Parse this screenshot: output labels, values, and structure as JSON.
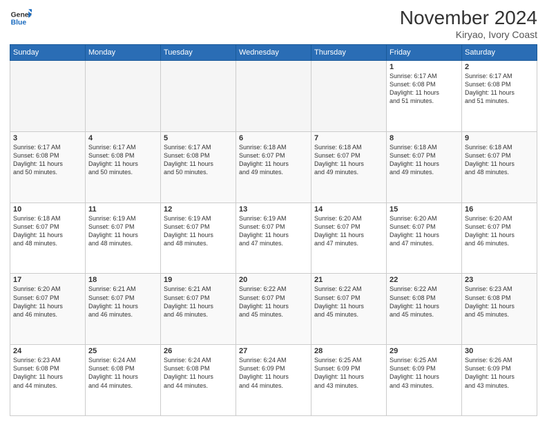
{
  "header": {
    "logo_line1": "General",
    "logo_line2": "Blue",
    "main_title": "November 2024",
    "subtitle": "Kiryao, Ivory Coast"
  },
  "weekdays": [
    "Sunday",
    "Monday",
    "Tuesday",
    "Wednesday",
    "Thursday",
    "Friday",
    "Saturday"
  ],
  "weeks": [
    [
      {
        "day": "",
        "info": ""
      },
      {
        "day": "",
        "info": ""
      },
      {
        "day": "",
        "info": ""
      },
      {
        "day": "",
        "info": ""
      },
      {
        "day": "",
        "info": ""
      },
      {
        "day": "1",
        "info": "Sunrise: 6:17 AM\nSunset: 6:08 PM\nDaylight: 11 hours\nand 51 minutes."
      },
      {
        "day": "2",
        "info": "Sunrise: 6:17 AM\nSunset: 6:08 PM\nDaylight: 11 hours\nand 51 minutes."
      }
    ],
    [
      {
        "day": "3",
        "info": "Sunrise: 6:17 AM\nSunset: 6:08 PM\nDaylight: 11 hours\nand 50 minutes."
      },
      {
        "day": "4",
        "info": "Sunrise: 6:17 AM\nSunset: 6:08 PM\nDaylight: 11 hours\nand 50 minutes."
      },
      {
        "day": "5",
        "info": "Sunrise: 6:17 AM\nSunset: 6:08 PM\nDaylight: 11 hours\nand 50 minutes."
      },
      {
        "day": "6",
        "info": "Sunrise: 6:18 AM\nSunset: 6:07 PM\nDaylight: 11 hours\nand 49 minutes."
      },
      {
        "day": "7",
        "info": "Sunrise: 6:18 AM\nSunset: 6:07 PM\nDaylight: 11 hours\nand 49 minutes."
      },
      {
        "day": "8",
        "info": "Sunrise: 6:18 AM\nSunset: 6:07 PM\nDaylight: 11 hours\nand 49 minutes."
      },
      {
        "day": "9",
        "info": "Sunrise: 6:18 AM\nSunset: 6:07 PM\nDaylight: 11 hours\nand 48 minutes."
      }
    ],
    [
      {
        "day": "10",
        "info": "Sunrise: 6:18 AM\nSunset: 6:07 PM\nDaylight: 11 hours\nand 48 minutes."
      },
      {
        "day": "11",
        "info": "Sunrise: 6:19 AM\nSunset: 6:07 PM\nDaylight: 11 hours\nand 48 minutes."
      },
      {
        "day": "12",
        "info": "Sunrise: 6:19 AM\nSunset: 6:07 PM\nDaylight: 11 hours\nand 48 minutes."
      },
      {
        "day": "13",
        "info": "Sunrise: 6:19 AM\nSunset: 6:07 PM\nDaylight: 11 hours\nand 47 minutes."
      },
      {
        "day": "14",
        "info": "Sunrise: 6:20 AM\nSunset: 6:07 PM\nDaylight: 11 hours\nand 47 minutes."
      },
      {
        "day": "15",
        "info": "Sunrise: 6:20 AM\nSunset: 6:07 PM\nDaylight: 11 hours\nand 47 minutes."
      },
      {
        "day": "16",
        "info": "Sunrise: 6:20 AM\nSunset: 6:07 PM\nDaylight: 11 hours\nand 46 minutes."
      }
    ],
    [
      {
        "day": "17",
        "info": "Sunrise: 6:20 AM\nSunset: 6:07 PM\nDaylight: 11 hours\nand 46 minutes."
      },
      {
        "day": "18",
        "info": "Sunrise: 6:21 AM\nSunset: 6:07 PM\nDaylight: 11 hours\nand 46 minutes."
      },
      {
        "day": "19",
        "info": "Sunrise: 6:21 AM\nSunset: 6:07 PM\nDaylight: 11 hours\nand 46 minutes."
      },
      {
        "day": "20",
        "info": "Sunrise: 6:22 AM\nSunset: 6:07 PM\nDaylight: 11 hours\nand 45 minutes."
      },
      {
        "day": "21",
        "info": "Sunrise: 6:22 AM\nSunset: 6:07 PM\nDaylight: 11 hours\nand 45 minutes."
      },
      {
        "day": "22",
        "info": "Sunrise: 6:22 AM\nSunset: 6:08 PM\nDaylight: 11 hours\nand 45 minutes."
      },
      {
        "day": "23",
        "info": "Sunrise: 6:23 AM\nSunset: 6:08 PM\nDaylight: 11 hours\nand 45 minutes."
      }
    ],
    [
      {
        "day": "24",
        "info": "Sunrise: 6:23 AM\nSunset: 6:08 PM\nDaylight: 11 hours\nand 44 minutes."
      },
      {
        "day": "25",
        "info": "Sunrise: 6:24 AM\nSunset: 6:08 PM\nDaylight: 11 hours\nand 44 minutes."
      },
      {
        "day": "26",
        "info": "Sunrise: 6:24 AM\nSunset: 6:08 PM\nDaylight: 11 hours\nand 44 minutes."
      },
      {
        "day": "27",
        "info": "Sunrise: 6:24 AM\nSunset: 6:09 PM\nDaylight: 11 hours\nand 44 minutes."
      },
      {
        "day": "28",
        "info": "Sunrise: 6:25 AM\nSunset: 6:09 PM\nDaylight: 11 hours\nand 43 minutes."
      },
      {
        "day": "29",
        "info": "Sunrise: 6:25 AM\nSunset: 6:09 PM\nDaylight: 11 hours\nand 43 minutes."
      },
      {
        "day": "30",
        "info": "Sunrise: 6:26 AM\nSunset: 6:09 PM\nDaylight: 11 hours\nand 43 minutes."
      }
    ]
  ]
}
